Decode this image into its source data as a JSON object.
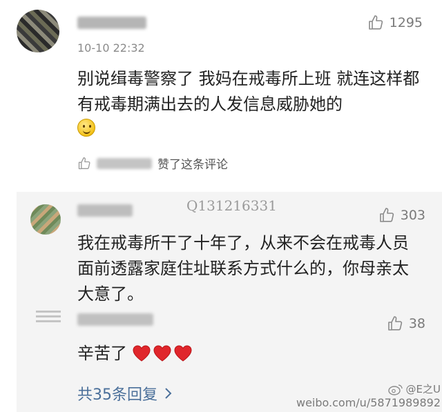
{
  "main_comment": {
    "time": "10-10 22:32",
    "likes": "1295",
    "text": "别说缉毒警察了 我妈在戒毒所上班 就连这样都有戒毒期满出去的人发信息威胁她的",
    "liked_by_suffix": "赞了这条评论"
  },
  "replies": [
    {
      "likes": "303",
      "text": "我在戒毒所干了十年了，从来不会在戒毒人员面前透露家庭住址联系方式什么的，你母亲太大意了。"
    },
    {
      "likes": "38",
      "text": "辛苦了"
    }
  ],
  "watermark_q": "Q131216331",
  "more_replies": "共35条回复",
  "weibo_watermark": {
    "handle": "@E之U",
    "url": "weibo.com/u/5871989892"
  },
  "colors": {
    "link": "#4a6f9a",
    "heart": "#e0262b",
    "reply_bg": "#f4f4f4"
  }
}
